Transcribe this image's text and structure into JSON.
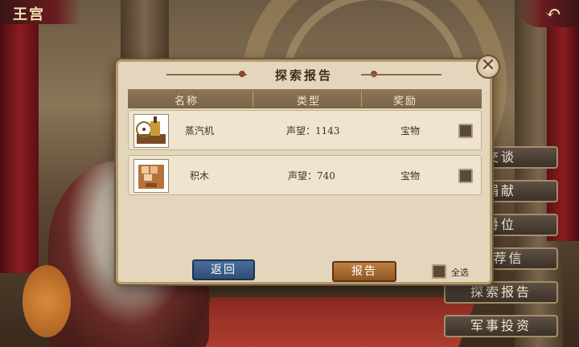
{
  "header": {
    "title": "王宫",
    "back_icon": "back-arrow-icon"
  },
  "side_menu": [
    {
      "label": "交谈"
    },
    {
      "label": "捐献"
    },
    {
      "label": "爵位"
    },
    {
      "label": "推荐信"
    },
    {
      "label": "探索报告"
    },
    {
      "label": "军事投资"
    }
  ],
  "dialog": {
    "title": "探索报告",
    "columns": [
      "名称",
      "类型",
      "奖励"
    ],
    "rows": [
      {
        "name": "蒸汽机",
        "type": "声望：1143",
        "reward": "宝物",
        "checked": false,
        "icon": "steam-engine-icon"
      },
      {
        "name": "积木",
        "type": "声望：740",
        "reward": "宝物",
        "checked": false,
        "icon": "wooden-blocks-icon"
      }
    ],
    "return_label": "返回",
    "report_label": "报告",
    "select_all_label": "全选"
  },
  "colors": {
    "return_button": "#3a5f8a",
    "report_button": "#a8693a",
    "panel": "#e3d6bd"
  }
}
